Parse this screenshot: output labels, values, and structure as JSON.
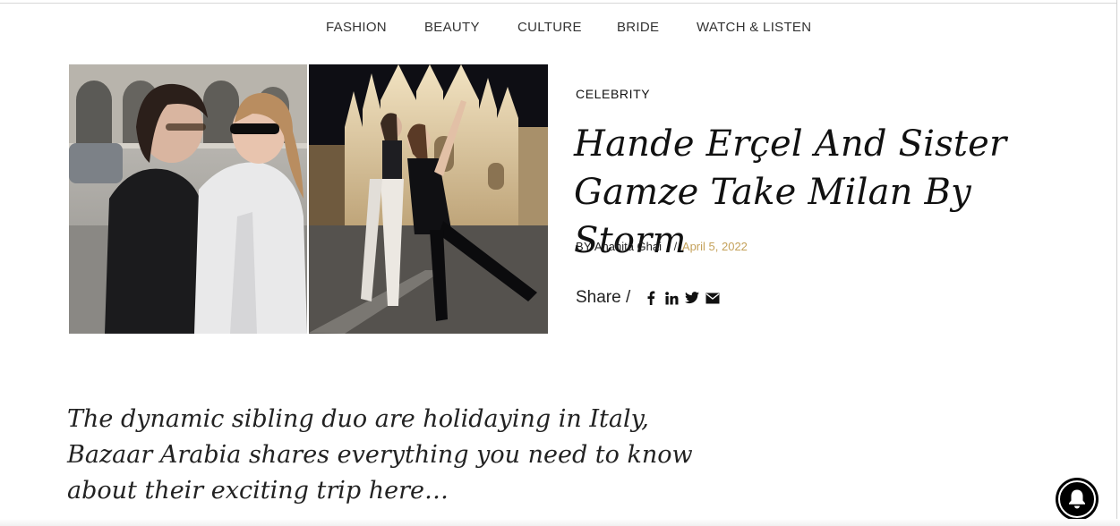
{
  "nav": {
    "items": [
      {
        "label": "FASHION"
      },
      {
        "label": "BEAUTY"
      },
      {
        "label": "CULTURE"
      },
      {
        "label": "BRIDE"
      },
      {
        "label": "WATCH & LISTEN"
      }
    ]
  },
  "article": {
    "category": "CELEBRITY",
    "title": "Hande Erçel And Sister Gamze Take Milan By Storm",
    "byline_prefix": "BY",
    "author": "Anahita Ghai",
    "date_separator": "/",
    "date": "April 5, 2022",
    "share_label": "Share /",
    "share_icons": [
      "facebook-icon",
      "linkedin-icon",
      "twitter-icon",
      "email-icon"
    ],
    "excerpt": "The dynamic sibling duo are holidaying in Italy, Bazaar Arabia shares everything you need to know about their exciting trip here…"
  },
  "colors": {
    "date": "#c4a15a",
    "text": "#111111",
    "notification_button": "#000000"
  }
}
